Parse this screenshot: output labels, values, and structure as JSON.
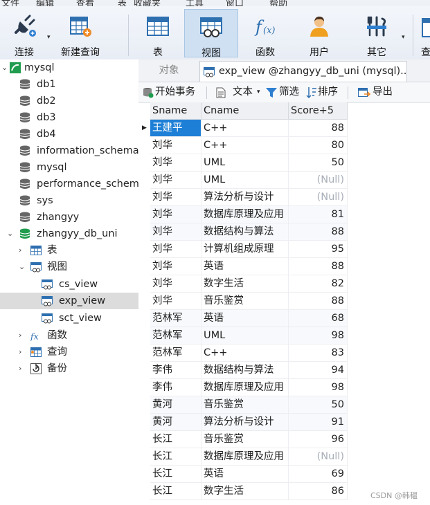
{
  "menubar": [
    "文件",
    "编辑",
    "查看",
    "表",
    "收藏夹",
    "工具",
    "窗口",
    "帮助"
  ],
  "toolbar": {
    "connect": "连接",
    "new_query": "新建查询",
    "table": "表",
    "view": "视图",
    "function": "函数",
    "user": "用户",
    "other": "其它",
    "query_partial": "查"
  },
  "tree": {
    "mysql": "mysql",
    "db1": "db1",
    "db2": "db2",
    "db3": "db3",
    "db4": "db4",
    "information_schema": "information_schema",
    "mysql_db": "mysql",
    "performance_schema": "performance_schema",
    "sys": "sys",
    "zhangyy": "zhangyy",
    "zhangyy_db_uni": "zhangyy_db_uni",
    "tables": "表",
    "views": "视图",
    "cs_view": "cs_view",
    "exp_view": "exp_view",
    "sct_view": "sct_view",
    "functions": "函数",
    "queries": "查询",
    "backups": "备份"
  },
  "tabs": {
    "objects": "对象",
    "active": "exp_view @zhangyy_db_uni (mysql)..."
  },
  "subtoolbar": {
    "begin_transaction": "开始事务",
    "text": "文本",
    "filter": "筛选",
    "sort": "排序",
    "export": "导出"
  },
  "grid": {
    "columns": [
      "Sname",
      "Cname",
      "Score+5"
    ],
    "rows": [
      [
        "王建平",
        "C++",
        "88"
      ],
      [
        "刘华",
        "C++",
        "80"
      ],
      [
        "刘华",
        "UML",
        "50"
      ],
      [
        "刘华",
        "UML",
        "(Null)"
      ],
      [
        "刘华",
        "算法分析与设计",
        "(Null)"
      ],
      [
        "刘华",
        "数据库原理及应用",
        "81"
      ],
      [
        "刘华",
        "数据结构与算法",
        "88"
      ],
      [
        "刘华",
        "计算机组成原理",
        "95"
      ],
      [
        "刘华",
        "英语",
        "88"
      ],
      [
        "刘华",
        "数字生活",
        "82"
      ],
      [
        "刘华",
        "音乐鉴赏",
        "88"
      ],
      [
        "范林军",
        "英语",
        "68"
      ],
      [
        "范林军",
        "UML",
        "98"
      ],
      [
        "范林军",
        "C++",
        "83"
      ],
      [
        "李伟",
        "数据结构与算法",
        "94"
      ],
      [
        "李伟",
        "数据库原理及应用",
        "98"
      ],
      [
        "黄河",
        "音乐鉴赏",
        "50"
      ],
      [
        "黄河",
        "算法分析与设计",
        "91"
      ],
      [
        "长江",
        "音乐鉴赏",
        "96"
      ],
      [
        "长江",
        "数据库原理及应用",
        "(Null)"
      ],
      [
        "长江",
        "英语",
        "69"
      ],
      [
        "长江",
        "数字生活",
        "86"
      ]
    ]
  },
  "watermark": "CSDN @韩韫",
  "colors": {
    "accent": "#1e7fd6",
    "null_text": "#a8aeb8",
    "selected_tool": "#cfe0f2"
  }
}
